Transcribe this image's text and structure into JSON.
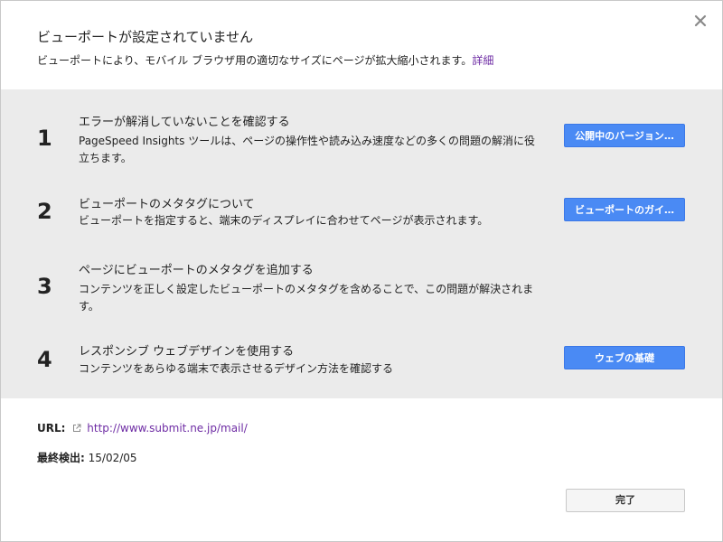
{
  "dialog": {
    "title": "ビューポートが設定されていません",
    "description": "ビューポートにより、モバイル ブラウザ用の適切なサイズにページが拡大縮小されます。",
    "details_link": "詳細"
  },
  "steps": [
    {
      "number": "1",
      "title": "エラーが解消していないことを確認する",
      "description": "PageSpeed Insights ツールは、ページの操作性や読み込み速度などの多くの問題の解消に役立ちます。",
      "button": "公開中のバージョン…"
    },
    {
      "number": "2",
      "title": "ビューポートのメタタグについて",
      "description": "ビューポートを指定すると、端末のディスプレイに合わせてページが表示されます。",
      "button": "ビューポートのガイ…"
    },
    {
      "number": "3",
      "title": "ページにビューポートのメタタグを追加する",
      "description": "コンテンツを正しく設定したビューポートのメタタグを含めることで、この問題が解決されます。"
    },
    {
      "number": "4",
      "title": "レスポンシブ ウェブデザインを使用する",
      "description": "コンテンツをあらゆる端末で表示させるデザイン方法を確認する",
      "button": "ウェブの基礎"
    }
  ],
  "meta": {
    "url_label": "URL:",
    "url": "http://www.submit.ne.jp/mail/",
    "detected_label": "最終検出:",
    "detected_date": "15/02/05"
  },
  "footer": {
    "done_label": "完了"
  },
  "icons": {
    "close": "close-icon",
    "external_link": "external-link-icon"
  },
  "colors": {
    "panel_bg": "#ebebeb",
    "primary_button": "#4a8af4",
    "link": "#6e2ca4"
  }
}
